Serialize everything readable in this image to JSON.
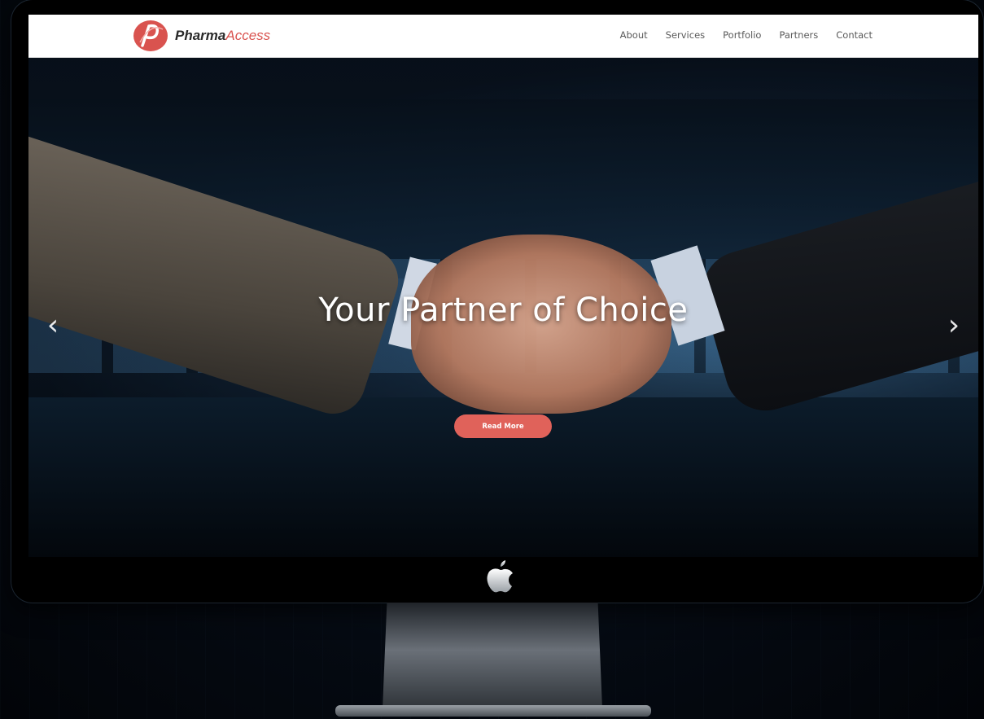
{
  "brand": {
    "name_part1": "Pharma",
    "name_part2": "Access",
    "logo_icon": "pharmaaccess-logo-icon",
    "accent_color": "#d9534f"
  },
  "nav": {
    "items": [
      {
        "label": "About"
      },
      {
        "label": "Services"
      },
      {
        "label": "Portfolio"
      },
      {
        "label": "Partners"
      },
      {
        "label": "Contact"
      }
    ]
  },
  "hero": {
    "title": "Your Partner of Choice",
    "button_label": "Read More",
    "button_color": "#e0625a",
    "prev_icon": "chevron-left-icon",
    "next_icon": "chevron-right-icon",
    "prev_glyph": "‹",
    "next_glyph": "›"
  },
  "device": {
    "logo_icon": "apple-logo-icon"
  }
}
